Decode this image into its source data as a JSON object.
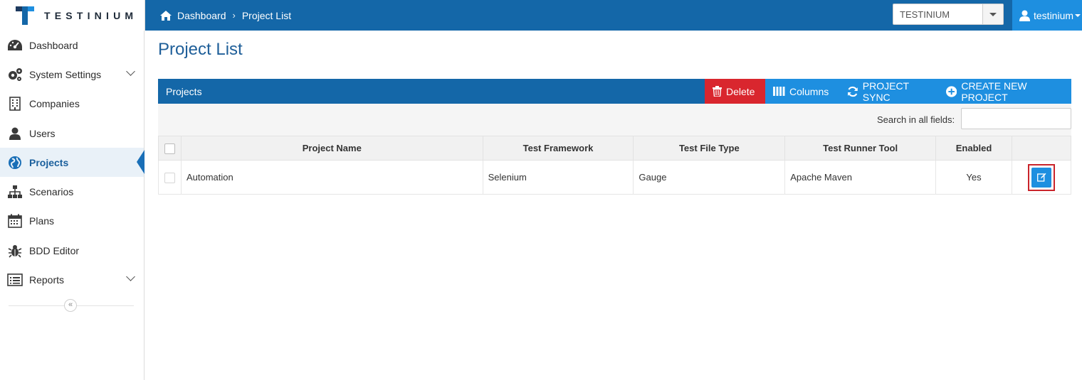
{
  "brand": {
    "name": "TESTINIUM"
  },
  "breadcrumb": {
    "home": "Dashboard",
    "current": "Project List"
  },
  "company_select": {
    "value": "TESTINIUM"
  },
  "user": {
    "name": "testinium"
  },
  "sidebar": {
    "items": [
      {
        "label": "Dashboard",
        "icon": "dashboard-icon"
      },
      {
        "label": "System Settings",
        "icon": "gears-icon",
        "expandable": true
      },
      {
        "label": "Companies",
        "icon": "building-icon"
      },
      {
        "label": "Users",
        "icon": "user-icon"
      },
      {
        "label": "Projects",
        "icon": "globe-icon",
        "active": true
      },
      {
        "label": "Scenarios",
        "icon": "sitemap-icon"
      },
      {
        "label": "Plans",
        "icon": "calendar-icon"
      },
      {
        "label": "BDD Editor",
        "icon": "bug-icon"
      },
      {
        "label": "Reports",
        "icon": "list-icon",
        "expandable": true
      }
    ],
    "collapse_symbol": "«"
  },
  "page": {
    "title": "Project List"
  },
  "panel": {
    "title": "Projects",
    "buttons": {
      "delete": "Delete",
      "columns": "Columns",
      "sync": "PROJECT SYNC",
      "create": "CREATE NEW PROJECT"
    }
  },
  "search": {
    "label": "Search in all fields:",
    "value": ""
  },
  "table": {
    "headers": [
      "Project Name",
      "Test Framework",
      "Test File Type",
      "Test Runner Tool",
      "Enabled"
    ],
    "rows": [
      {
        "name": "Automation",
        "framework": "Selenium",
        "file_type": "Gauge",
        "runner": "Apache Maven",
        "enabled": "Yes"
      }
    ]
  },
  "colors": {
    "primary": "#1467a8",
    "accent": "#1e8fe0",
    "danger": "#d9262e",
    "highlight": "#c9242b"
  }
}
